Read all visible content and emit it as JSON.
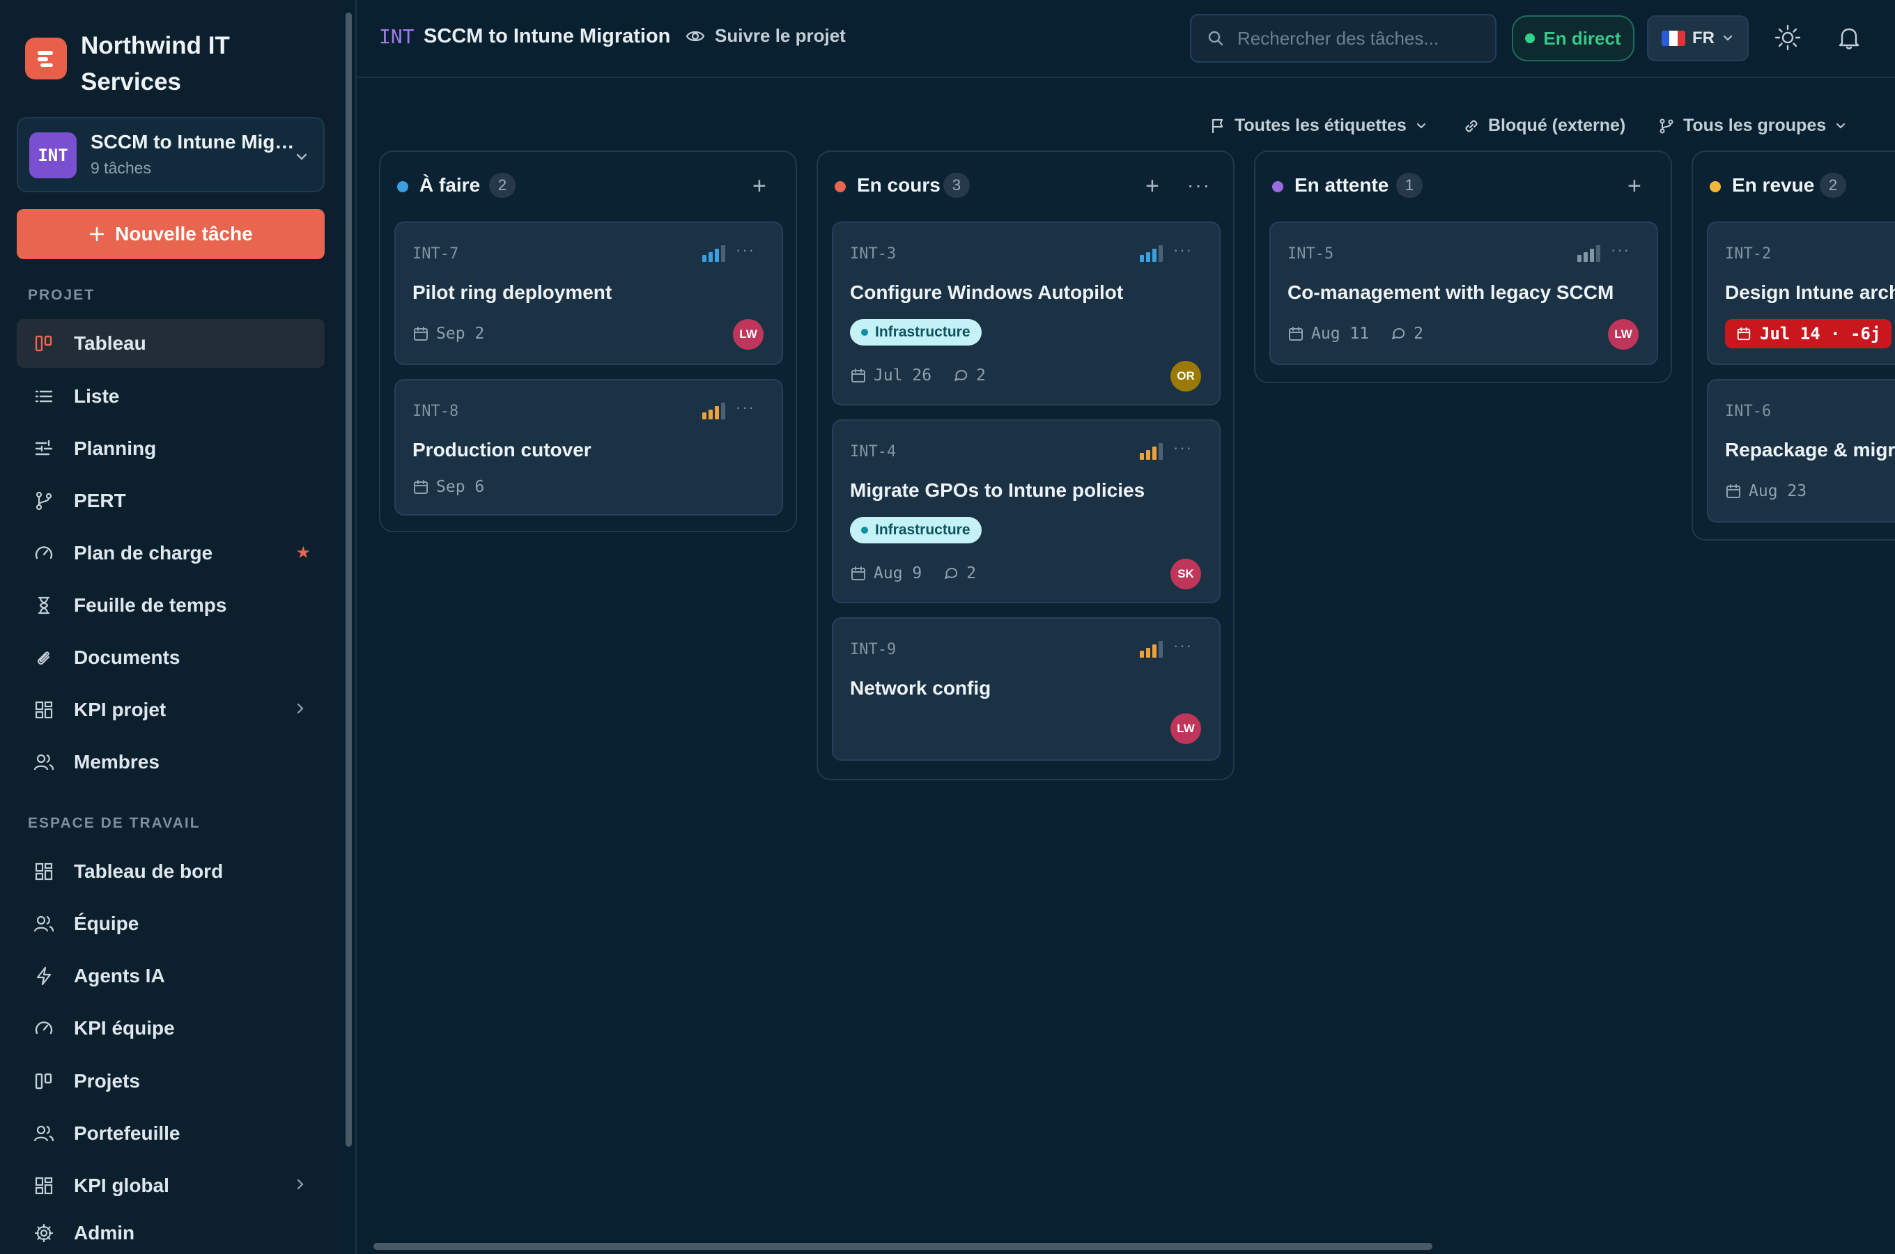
{
  "brand": {
    "name": "Northwind IT Services"
  },
  "project_switcher": {
    "badge": "INT",
    "name": "SCCM to Intune Mig…",
    "subtitle": "9 tâches"
  },
  "new_task_label": "Nouvelle tâche",
  "sidebar": {
    "project_section": "PROJET",
    "project_items": [
      {
        "label": "Tableau",
        "icon": "board-icon",
        "active": true
      },
      {
        "label": "Liste",
        "icon": "list-icon"
      },
      {
        "label": "Planning",
        "icon": "timeline-icon"
      },
      {
        "label": "PERT",
        "icon": "branch-icon"
      },
      {
        "label": "Plan de charge",
        "icon": "gauge-icon",
        "starred": true
      },
      {
        "label": "Feuille de temps",
        "icon": "hourglass-icon"
      },
      {
        "label": "Documents",
        "icon": "paperclip-icon"
      },
      {
        "label": "KPI projet",
        "icon": "dashboard-icon",
        "expandable": true
      },
      {
        "label": "Membres",
        "icon": "users-icon"
      }
    ],
    "workspace_section": "ESPACE DE TRAVAIL",
    "workspace_items": [
      {
        "label": "Tableau de bord",
        "icon": "dashboard-icon"
      },
      {
        "label": "Équipe",
        "icon": "users-icon"
      },
      {
        "label": "Agents IA",
        "icon": "bolt-icon"
      },
      {
        "label": "KPI équipe",
        "icon": "gauge-icon"
      },
      {
        "label": "Projets",
        "icon": "board-icon"
      },
      {
        "label": "Portefeuille",
        "icon": "users-icon"
      },
      {
        "label": "KPI global",
        "icon": "dashboard-icon",
        "expandable": true
      },
      {
        "label": "Admin",
        "icon": "gear-icon"
      }
    ]
  },
  "topbar": {
    "project_key": "INT",
    "project_title": "SCCM to Intune Migration",
    "follow_label": "Suivre le projet",
    "search_placeholder": "Rechercher des tâches...",
    "live_label": "En direct",
    "language": "FR"
  },
  "filters": {
    "labels": "Toutes les étiquettes",
    "blocked": "Bloqué (externe)",
    "groups": "Tous les groupes"
  },
  "columns": [
    {
      "title": "À faire",
      "count": "2",
      "color": "#3b9fe0",
      "cards": [
        {
          "key": "INT-7",
          "title": "Pilot ring deployment",
          "date": "Sep 2",
          "avatar": "LW",
          "avatar_color": "#c0365a",
          "priority_color": "#3b9fe0"
        },
        {
          "key": "INT-8",
          "title": "Production cutover",
          "date": "Sep 6",
          "priority_color": "#f0a23a"
        }
      ]
    },
    {
      "title": "En cours",
      "count": "3",
      "color": "#e8654f",
      "cards": [
        {
          "key": "INT-3",
          "title": "Configure Windows Autopilot",
          "tag": "Infrastructure",
          "date": "Jul 26",
          "comments": "2",
          "avatar": "OR",
          "avatar_color": "#9a7a05",
          "priority_color": "#3b9fe0"
        },
        {
          "key": "INT-4",
          "title": "Migrate GPOs to Intune policies",
          "tag": "Infrastructure",
          "date": "Aug 9",
          "comments": "2",
          "avatar": "SK",
          "avatar_color": "#c0365a",
          "priority_color": "#f0a23a"
        },
        {
          "key": "INT-9",
          "title": "Network config",
          "avatar": "LW",
          "avatar_color": "#c0365a",
          "priority_color": "#f0a23a"
        }
      ]
    },
    {
      "title": "En attente",
      "count": "1",
      "color": "#9d6be0",
      "cards": [
        {
          "key": "INT-5",
          "title": "Co-management with legacy SCCM",
          "date": "Aug 11",
          "comments": "2",
          "avatar": "LW",
          "avatar_color": "#c0365a",
          "priority_color": "#8496a4"
        }
      ]
    },
    {
      "title": "En revue",
      "count": "2",
      "color": "#f2b83b",
      "cards": [
        {
          "key": "INT-2",
          "title": "Design Intune architecture",
          "overdue": "Jul 14 · -6j"
        },
        {
          "key": "INT-6",
          "title": "Repackage & migrate apps",
          "date": "Aug 23"
        }
      ]
    }
  ]
}
